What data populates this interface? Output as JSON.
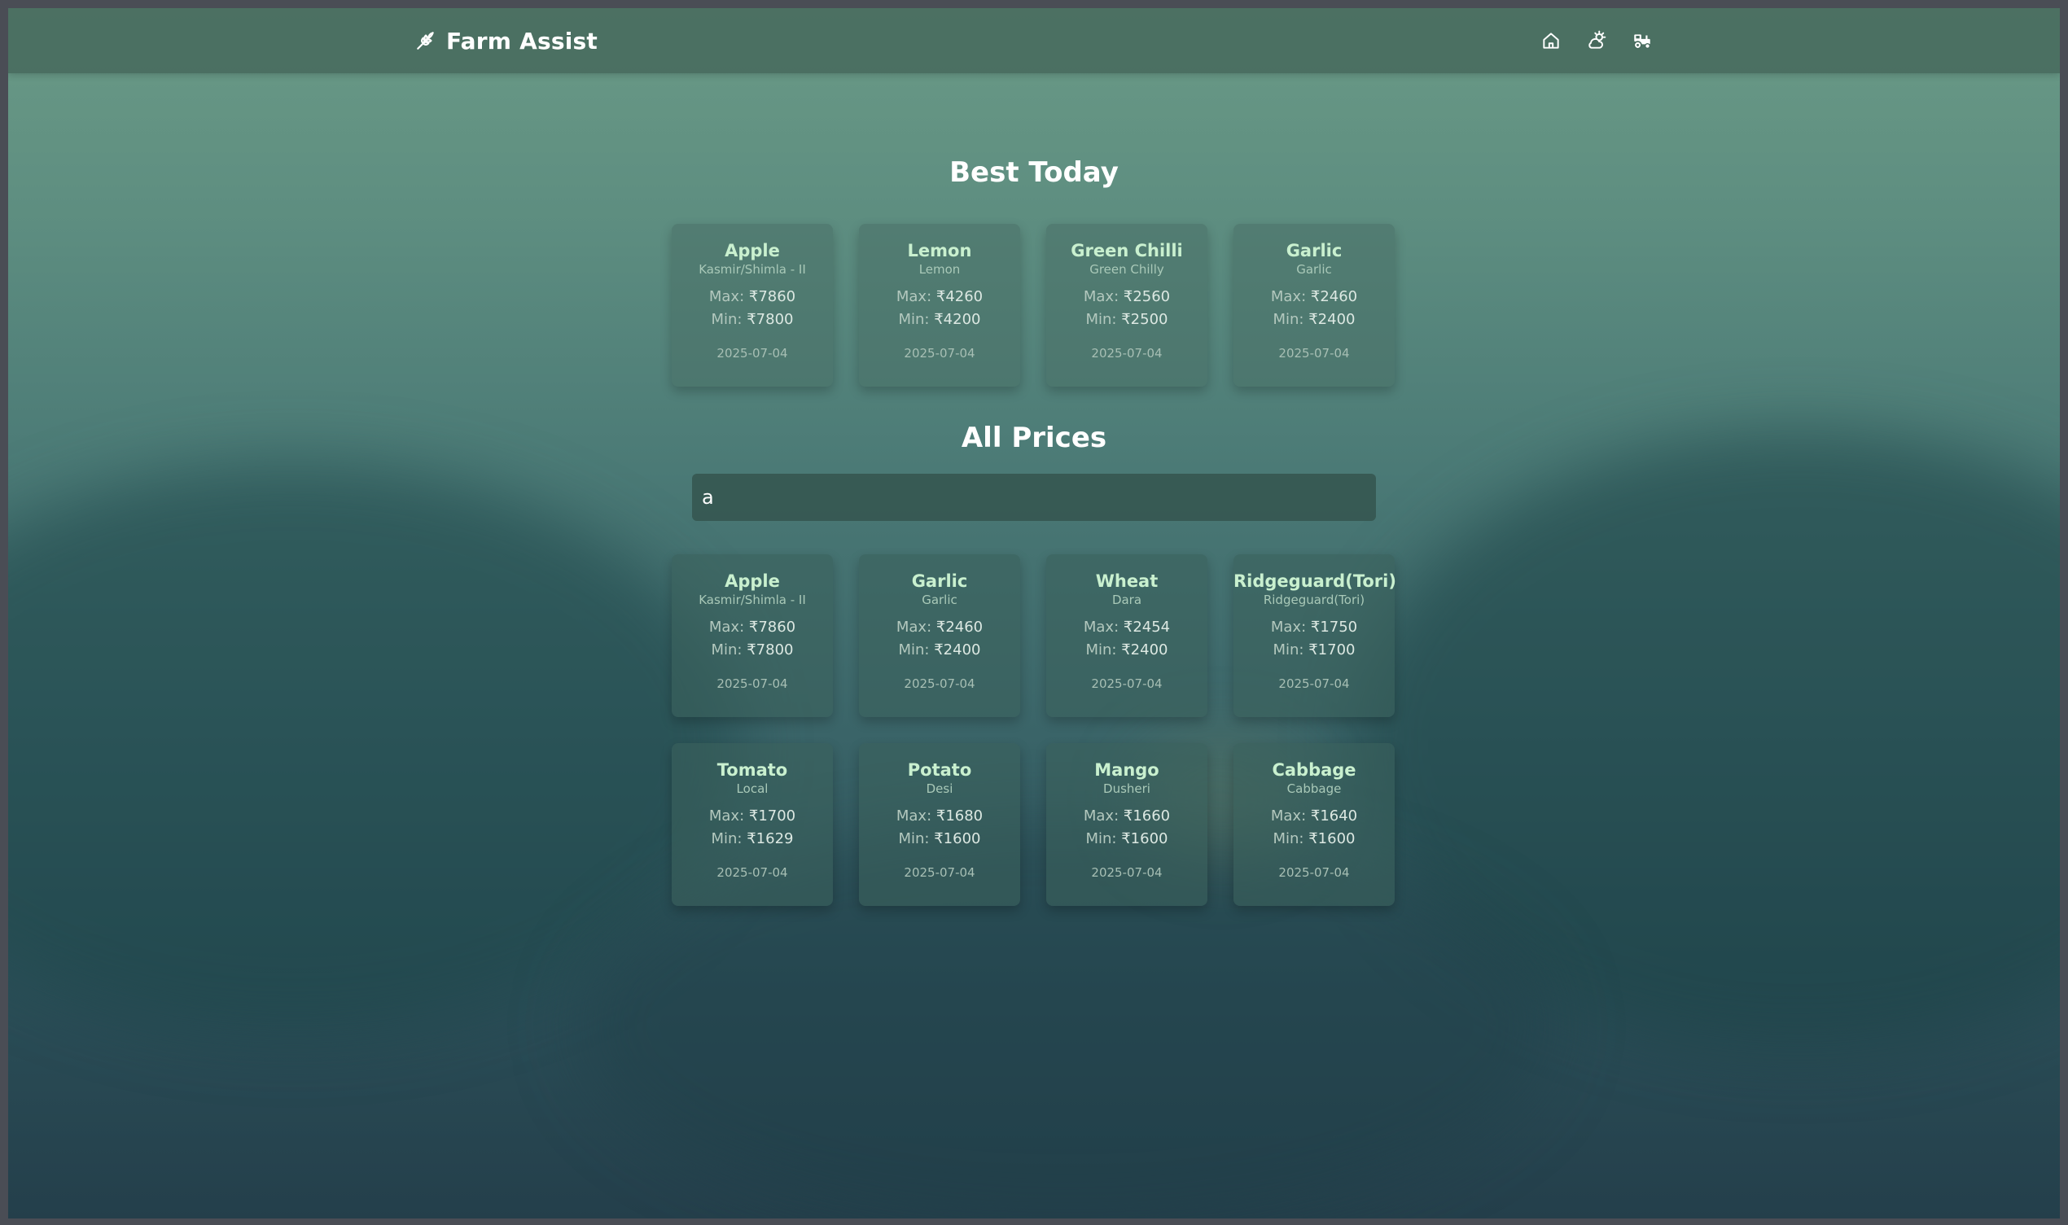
{
  "header": {
    "brand": "Farm Assist",
    "icons": [
      "home-icon",
      "weather-icon",
      "tractor-icon"
    ]
  },
  "best_today": {
    "title": "Best Today",
    "cards": [
      {
        "name": "Apple",
        "variety": "Kasmir/Shimla - II",
        "max": "₹7860",
        "min": "₹7800",
        "date": "2025-07-04"
      },
      {
        "name": "Lemon",
        "variety": "Lemon",
        "max": "₹4260",
        "min": "₹4200",
        "date": "2025-07-04"
      },
      {
        "name": "Green Chilli",
        "variety": "Green Chilly",
        "max": "₹2560",
        "min": "₹2500",
        "date": "2025-07-04"
      },
      {
        "name": "Garlic",
        "variety": "Garlic",
        "max": "₹2460",
        "min": "₹2400",
        "date": "2025-07-04"
      }
    ]
  },
  "all_prices": {
    "title": "All Prices",
    "search_value": "a",
    "cards": [
      {
        "name": "Apple",
        "variety": "Kasmir/Shimla - II",
        "max": "₹7860",
        "min": "₹7800",
        "date": "2025-07-04"
      },
      {
        "name": "Garlic",
        "variety": "Garlic",
        "max": "₹2460",
        "min": "₹2400",
        "date": "2025-07-04"
      },
      {
        "name": "Wheat",
        "variety": "Dara",
        "max": "₹2454",
        "min": "₹2400",
        "date": "2025-07-04"
      },
      {
        "name": "Ridgeguard(Tori)",
        "variety": "Ridgeguard(Tori)",
        "max": "₹1750",
        "min": "₹1700",
        "date": "2025-07-04"
      },
      {
        "name": "Tomato",
        "variety": "Local",
        "max": "₹1700",
        "min": "₹1629",
        "date": "2025-07-04"
      },
      {
        "name": "Potato",
        "variety": "Desi",
        "max": "₹1680",
        "min": "₹1600",
        "date": "2025-07-04"
      },
      {
        "name": "Mango",
        "variety": "Dusheri",
        "max": "₹1660",
        "min": "₹1600",
        "date": "2025-07-04"
      },
      {
        "name": "Cabbage",
        "variety": "Cabbage",
        "max": "₹1640",
        "min": "₹1600",
        "date": "2025-07-04"
      }
    ]
  },
  "labels": {
    "max": "Max:",
    "min": "Min:"
  }
}
